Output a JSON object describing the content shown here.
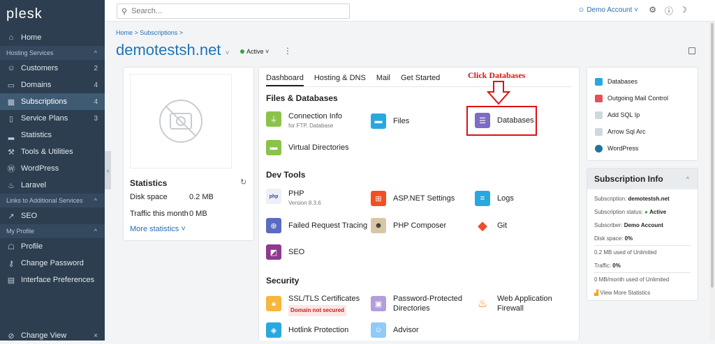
{
  "app": {
    "logo": "plesk"
  },
  "sidebar": {
    "home": "Home",
    "section_hosting": "Hosting Services",
    "items": [
      {
        "label": "Customers",
        "count": "2"
      },
      {
        "label": "Domains",
        "count": "4"
      },
      {
        "label": "Subscriptions",
        "count": "4"
      },
      {
        "label": "Service Plans",
        "count": "3"
      },
      {
        "label": "Statistics",
        "count": ""
      },
      {
        "label": "Tools & Utilities",
        "count": ""
      },
      {
        "label": "WordPress",
        "count": ""
      },
      {
        "label": "Laravel",
        "count": ""
      }
    ],
    "section_links": "Links to Additional Services",
    "seo": "SEO",
    "section_profile": "My Profile",
    "profile_items": [
      "Profile",
      "Change Password",
      "Interface Preferences"
    ],
    "change_view": "Change View"
  },
  "topbar": {
    "search_placeholder": "Search...",
    "account": "Demo Account"
  },
  "breadcrumb": "Home > Subscriptions >",
  "page": {
    "title": "demotestsh.net",
    "status": "Active"
  },
  "statistics": {
    "heading": "Statistics",
    "disk_label": "Disk space",
    "disk_value": "0.2 MB",
    "traffic_label": "Traffic this month",
    "traffic_value": "0 MB",
    "more": "More statistics"
  },
  "tabs": [
    "Dashboard",
    "Hosting & DNS",
    "Mail",
    "Get Started"
  ],
  "sections": {
    "files": "Files & Databases",
    "dev": "Dev Tools",
    "security": "Security"
  },
  "tools": {
    "connection": "Connection Info",
    "connection_sub": "for FTP, Database",
    "files": "Files",
    "databases": "Databases",
    "virtual": "Virtual Directories",
    "php": "PHP",
    "php_sub": "Version 8.3.6",
    "aspnet": "ASP.NET Settings",
    "logs": "Logs",
    "failed": "Failed Request Tracing",
    "composer": "PHP Composer",
    "git": "Git",
    "seo": "SEO",
    "ssl": "SSL/TLS Certificates",
    "ssl_badge": "Domain not secured",
    "pwd1": "Password-Protected",
    "pwd2": "Directories",
    "waf1": "Web Application",
    "waf2": "Firewall",
    "hotlink": "Hotlink Protection",
    "advisor": "Advisor"
  },
  "annotation": "Click Databases",
  "right_list": [
    "Databases",
    "Outgoing Mail Control",
    "Add SQL Ip",
    "Arrow Sql Arc",
    "WordPress"
  ],
  "sub_info": {
    "heading": "Subscription Info",
    "subscription_label": "Subscription:",
    "subscription_value": "demotestsh.net",
    "status_label": "Subscription status:",
    "status_value": "Active",
    "subscriber_label": "Subscriber:",
    "subscriber_value": "Demo Account",
    "disk_label": "Disk space:",
    "disk_value": "0%",
    "disk_used": "0.2 MB used of Unlimited",
    "traffic_label": "Traffic:",
    "traffic_value": "0%",
    "traffic_used": "0 MB/month used of Unlimited",
    "view_more": "View More Statistics"
  }
}
